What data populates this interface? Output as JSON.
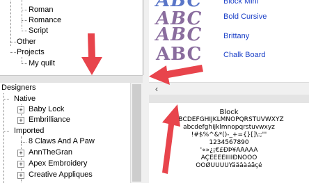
{
  "top_tree": {
    "items": [
      {
        "label": "Roman"
      },
      {
        "label": "Romance"
      },
      {
        "label": "Script"
      },
      {
        "label": "Other"
      },
      {
        "label": "Projects"
      },
      {
        "label": "My quilt"
      }
    ]
  },
  "designers_tree": {
    "root": "Designers",
    "native": "Native",
    "native_children": [
      "Baby Lock",
      "Embrilliance"
    ],
    "imported": "Imported",
    "imported_children": [
      "8 Claws And A Paw",
      "AnnTheGran",
      "Apex Embroidery",
      "Creative Appliques"
    ]
  },
  "font_list": {
    "items": [
      {
        "sample": "ABC",
        "name": "Block Mini"
      },
      {
        "sample": "ABC",
        "name": "Bold Cursive"
      },
      {
        "sample": "ABC",
        "name": "Brittany"
      },
      {
        "sample": "ABC",
        "name": "Chalk Board"
      }
    ]
  },
  "preview": {
    "title": "Block",
    "lines": [
      "ABCDEFGHIJKLMNOPQRSTUVWXYZ",
      "abcdefghijklmnopqrstuvwxyz",
      "!#$%^&*()-_+={}[]\\:;\"'",
      "1234567890",
      "'«»¿¡€£ÐÞ¥ÄÅÂÀÁ",
      "ÃÇÉÊËÈÍÎÏÌÐÑÖÓÔ",
      "ÕÒØÜÚÛÙÝäåâàáãçé"
    ]
  },
  "colors": {
    "arrow": "#e8444c",
    "font_name_link": "#1a3fc7",
    "sample_fill": "#8a6d9e"
  }
}
